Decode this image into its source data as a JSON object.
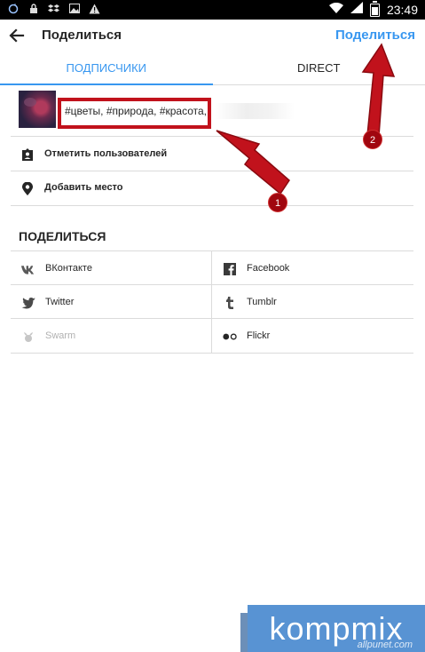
{
  "status_bar": {
    "time": "23:49",
    "left_icons": [
      "sync-icon",
      "lock-icon",
      "dropbox-icon",
      "image-icon",
      "warning-icon"
    ],
    "right_icons": [
      "wifi-icon",
      "signal-icon",
      "battery-icon"
    ]
  },
  "header": {
    "title": "Поделиться",
    "share_label": "Поделиться",
    "back_icon": "arrow-left-icon"
  },
  "tabs": [
    {
      "label": "ПОДПИСЧИКИ",
      "active": true
    },
    {
      "label": "DIRECT",
      "active": false
    }
  ],
  "caption": {
    "value": "#цветы, #природа, #красота,"
  },
  "options": [
    {
      "label": "Отметить пользователей",
      "icon": "tag-person-icon"
    },
    {
      "label": "Добавить место",
      "icon": "location-pin-icon"
    }
  ],
  "share": {
    "title": "ПОДЕЛИТЬСЯ",
    "items": [
      {
        "label": "ВКонтакте",
        "icon": "vk-icon",
        "enabled": true
      },
      {
        "label": "Facebook",
        "icon": "facebook-icon",
        "enabled": true
      },
      {
        "label": "Twitter",
        "icon": "twitter-icon",
        "enabled": true
      },
      {
        "label": "Tumblr",
        "icon": "tumblr-icon",
        "enabled": true
      },
      {
        "label": "Swarm",
        "icon": "swarm-icon",
        "enabled": false
      },
      {
        "label": "Flickr",
        "icon": "flickr-icon",
        "enabled": true
      }
    ]
  },
  "annotations": {
    "badge_1": "1",
    "badge_2": "2",
    "color": "#c1121c"
  },
  "watermark": {
    "text": "kompmix",
    "sub": "allpunet.com"
  },
  "colors": {
    "accent": "#3897f0",
    "text": "#262626",
    "divider": "#dbdbdb"
  }
}
